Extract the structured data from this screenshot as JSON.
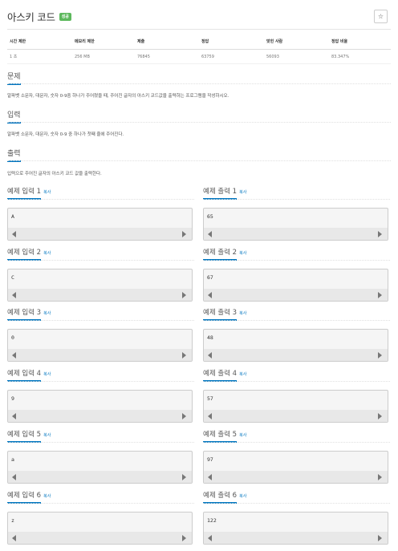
{
  "problem": {
    "title": "아스키 코드",
    "badge": "성공",
    "star_icon": "☆"
  },
  "info_table": {
    "headers": [
      "시간 제한",
      "메모리 제한",
      "제출",
      "정답",
      "맞힌 사람",
      "정답 비율"
    ],
    "row": [
      "1 초",
      "256 MB",
      "76845",
      "63759",
      "56093",
      "83.347%"
    ]
  },
  "sections": {
    "problem_title": "문제",
    "problem_text": "알파벳 소문자, 대문자, 숫자 0-9중 하나가 주어졌을 때, 주어진 글자의 아스키 코드값을 출력하는 프로그램을 작성하시오.",
    "input_title": "입력",
    "input_text": "알파벳 소문자, 대문자, 숫자 0-9 중 하나가 첫째 줄에 주어진다.",
    "output_title": "출력",
    "output_text": "입력으로 주어진 글자의 아스키 코드 값을 출력한다."
  },
  "copy_label": "복사",
  "examples": [
    {
      "in_label": "예제 입력 1",
      "in_val": "A",
      "out_label": "예제 출력 1",
      "out_val": "65"
    },
    {
      "in_label": "예제 입력 2",
      "in_val": "C",
      "out_label": "예제 출력 2",
      "out_val": "67"
    },
    {
      "in_label": "예제 입력 3",
      "in_val": "0",
      "out_label": "예제 출력 3",
      "out_val": "48"
    },
    {
      "in_label": "예제 입력 4",
      "in_val": "9",
      "out_label": "예제 출력 4",
      "out_val": "57"
    },
    {
      "in_label": "예제 입력 5",
      "in_val": "a",
      "out_label": "예제 출력 5",
      "out_val": "97"
    },
    {
      "in_label": "예제 입력 6",
      "in_val": "z",
      "out_label": "예제 출력 6",
      "out_val": "122"
    }
  ]
}
